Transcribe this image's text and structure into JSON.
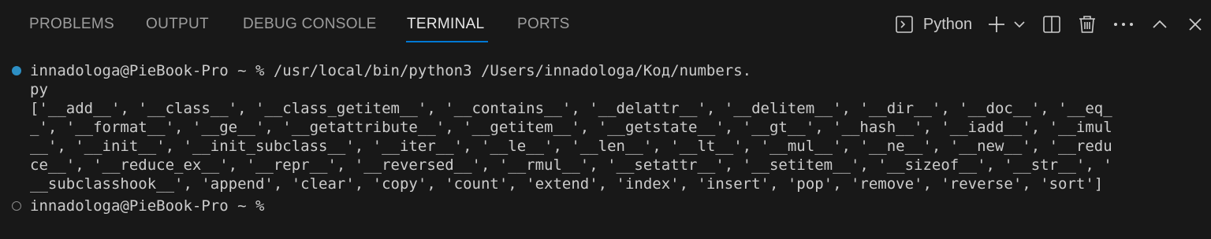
{
  "panel": {
    "tabs": [
      {
        "label": "PROBLEMS",
        "active": false
      },
      {
        "label": "OUTPUT",
        "active": false
      },
      {
        "label": "DEBUG CONSOLE",
        "active": false
      },
      {
        "label": "TERMINAL",
        "active": true
      },
      {
        "label": "PORTS",
        "active": false
      }
    ],
    "terminal_name": "Python",
    "accent_color": "#0078d4",
    "icons": [
      "terminal-icon",
      "plus-icon",
      "chevron-down-icon",
      "split-icon",
      "trash-icon",
      "ellipsis-icon",
      "chevron-up-icon",
      "close-icon"
    ]
  },
  "terminal": {
    "lines": [
      "innadologa@PieBook-Pro ~ % /usr/local/bin/python3 /Users/innadologa/Код/numbers.",
      "py",
      "['__add__', '__class__', '__class_getitem__', '__contains__', '__delattr__', '__delitem__', '__dir__', '__doc__', '__eq_",
      "_', '__format__', '__ge__', '__getattribute__', '__getitem__', '__getstate__', '__gt__', '__hash__', '__iadd__', '__imul",
      "__', '__init__', '__init_subclass__', '__iter__', '__le__', '__len__', '__lt__', '__mul__', '__ne__', '__new__', '__redu",
      "ce__', '__reduce_ex__', '__repr__', '__reversed__', '__rmul__', '__setattr__', '__setitem__', '__sizeof__', '__str__', '",
      "__subclasshook__', 'append', 'clear', 'copy', 'count', 'extend', 'index', 'insert', 'pop', 'remove', 'reverse', 'sort']",
      "innadologa@PieBook-Pro ~ %"
    ]
  }
}
